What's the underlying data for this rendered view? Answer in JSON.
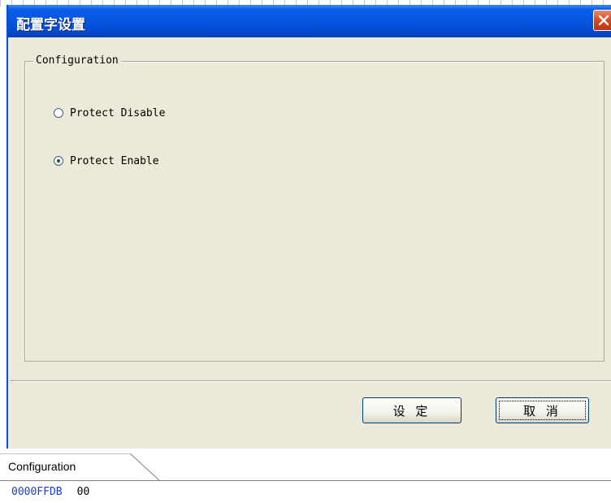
{
  "dialog": {
    "title": "配置字设置",
    "group_label": "Configuration",
    "options": [
      {
        "label": "Protect Disable",
        "selected": false
      },
      {
        "label": "Protect Enable",
        "selected": true
      }
    ],
    "set_button": "设 定",
    "cancel_button": "取 消"
  },
  "tab": {
    "label": "Configuration"
  },
  "row": {
    "address": "0000FFDB",
    "value": "00"
  },
  "colors": {
    "titlebar": "#0554e0",
    "dialog_bg": "#ece9d8",
    "address_text": "#1a3bd6"
  }
}
